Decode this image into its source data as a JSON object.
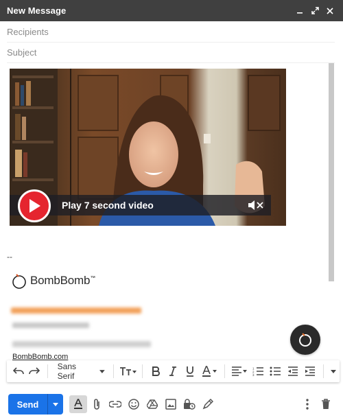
{
  "window": {
    "title": "New Message",
    "controls": [
      "minimize-icon",
      "expand-icon",
      "close-icon"
    ]
  },
  "fields": {
    "recipients_placeholder": "Recipients",
    "subject_placeholder": "Subject"
  },
  "video": {
    "play_label": "Play 7 second video",
    "accent": "#e5252f"
  },
  "signature": {
    "separator": "--",
    "brand": "BombBomb",
    "trademark": "™",
    "link": "BombBomb.com"
  },
  "toolbar": {
    "font": "Sans Serif",
    "icons": [
      "undo-icon",
      "redo-icon",
      "font-family-select",
      "font-size-icon",
      "bold-icon",
      "italic-icon",
      "underline-icon",
      "text-color-icon",
      "align-icon",
      "numbered-list-icon",
      "bulleted-list-icon",
      "indent-less-icon",
      "indent-more-icon",
      "more-formatting-icon"
    ]
  },
  "bottom": {
    "send_label": "Send",
    "accent": "#1a73e8",
    "icons": [
      "formatting-options-icon",
      "attach-icon",
      "link-icon",
      "emoji-icon",
      "drive-icon",
      "photo-icon",
      "confidential-icon",
      "signature-icon",
      "more-options-icon",
      "discard-icon"
    ]
  }
}
